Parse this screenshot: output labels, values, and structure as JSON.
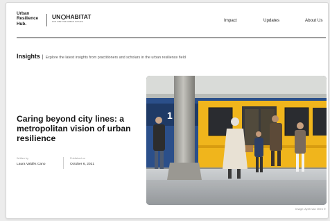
{
  "header": {
    "brand_lines": [
      "Urban",
      "Resilience",
      "Hub."
    ],
    "un_logo": {
      "prefix": "UN",
      "suffix": "HABITAT",
      "tagline": "FOR A BETTER URBAN FUTURE"
    },
    "nav": [
      {
        "label": "Impact"
      },
      {
        "label": "Updates"
      },
      {
        "label": "About Us"
      }
    ]
  },
  "insights": {
    "title": "Insights",
    "separator": "|",
    "description": "Explore the latest insights from practitioners and scholars in the urban resilience field"
  },
  "article": {
    "title": "Caring beyond city lines: a metropolitan vision of urban resilience",
    "author_label": "Written by",
    "author": "Laura Valdés Cano",
    "date_label": "Published on",
    "date": "October 6, 2021",
    "image_caption": "Image: Ayeh van Veen ©"
  },
  "colors": {
    "train_yellow": "#f0b51c",
    "train_blue": "#2b4f8a",
    "background": "#ffffff",
    "text": "#1d1d1d"
  }
}
